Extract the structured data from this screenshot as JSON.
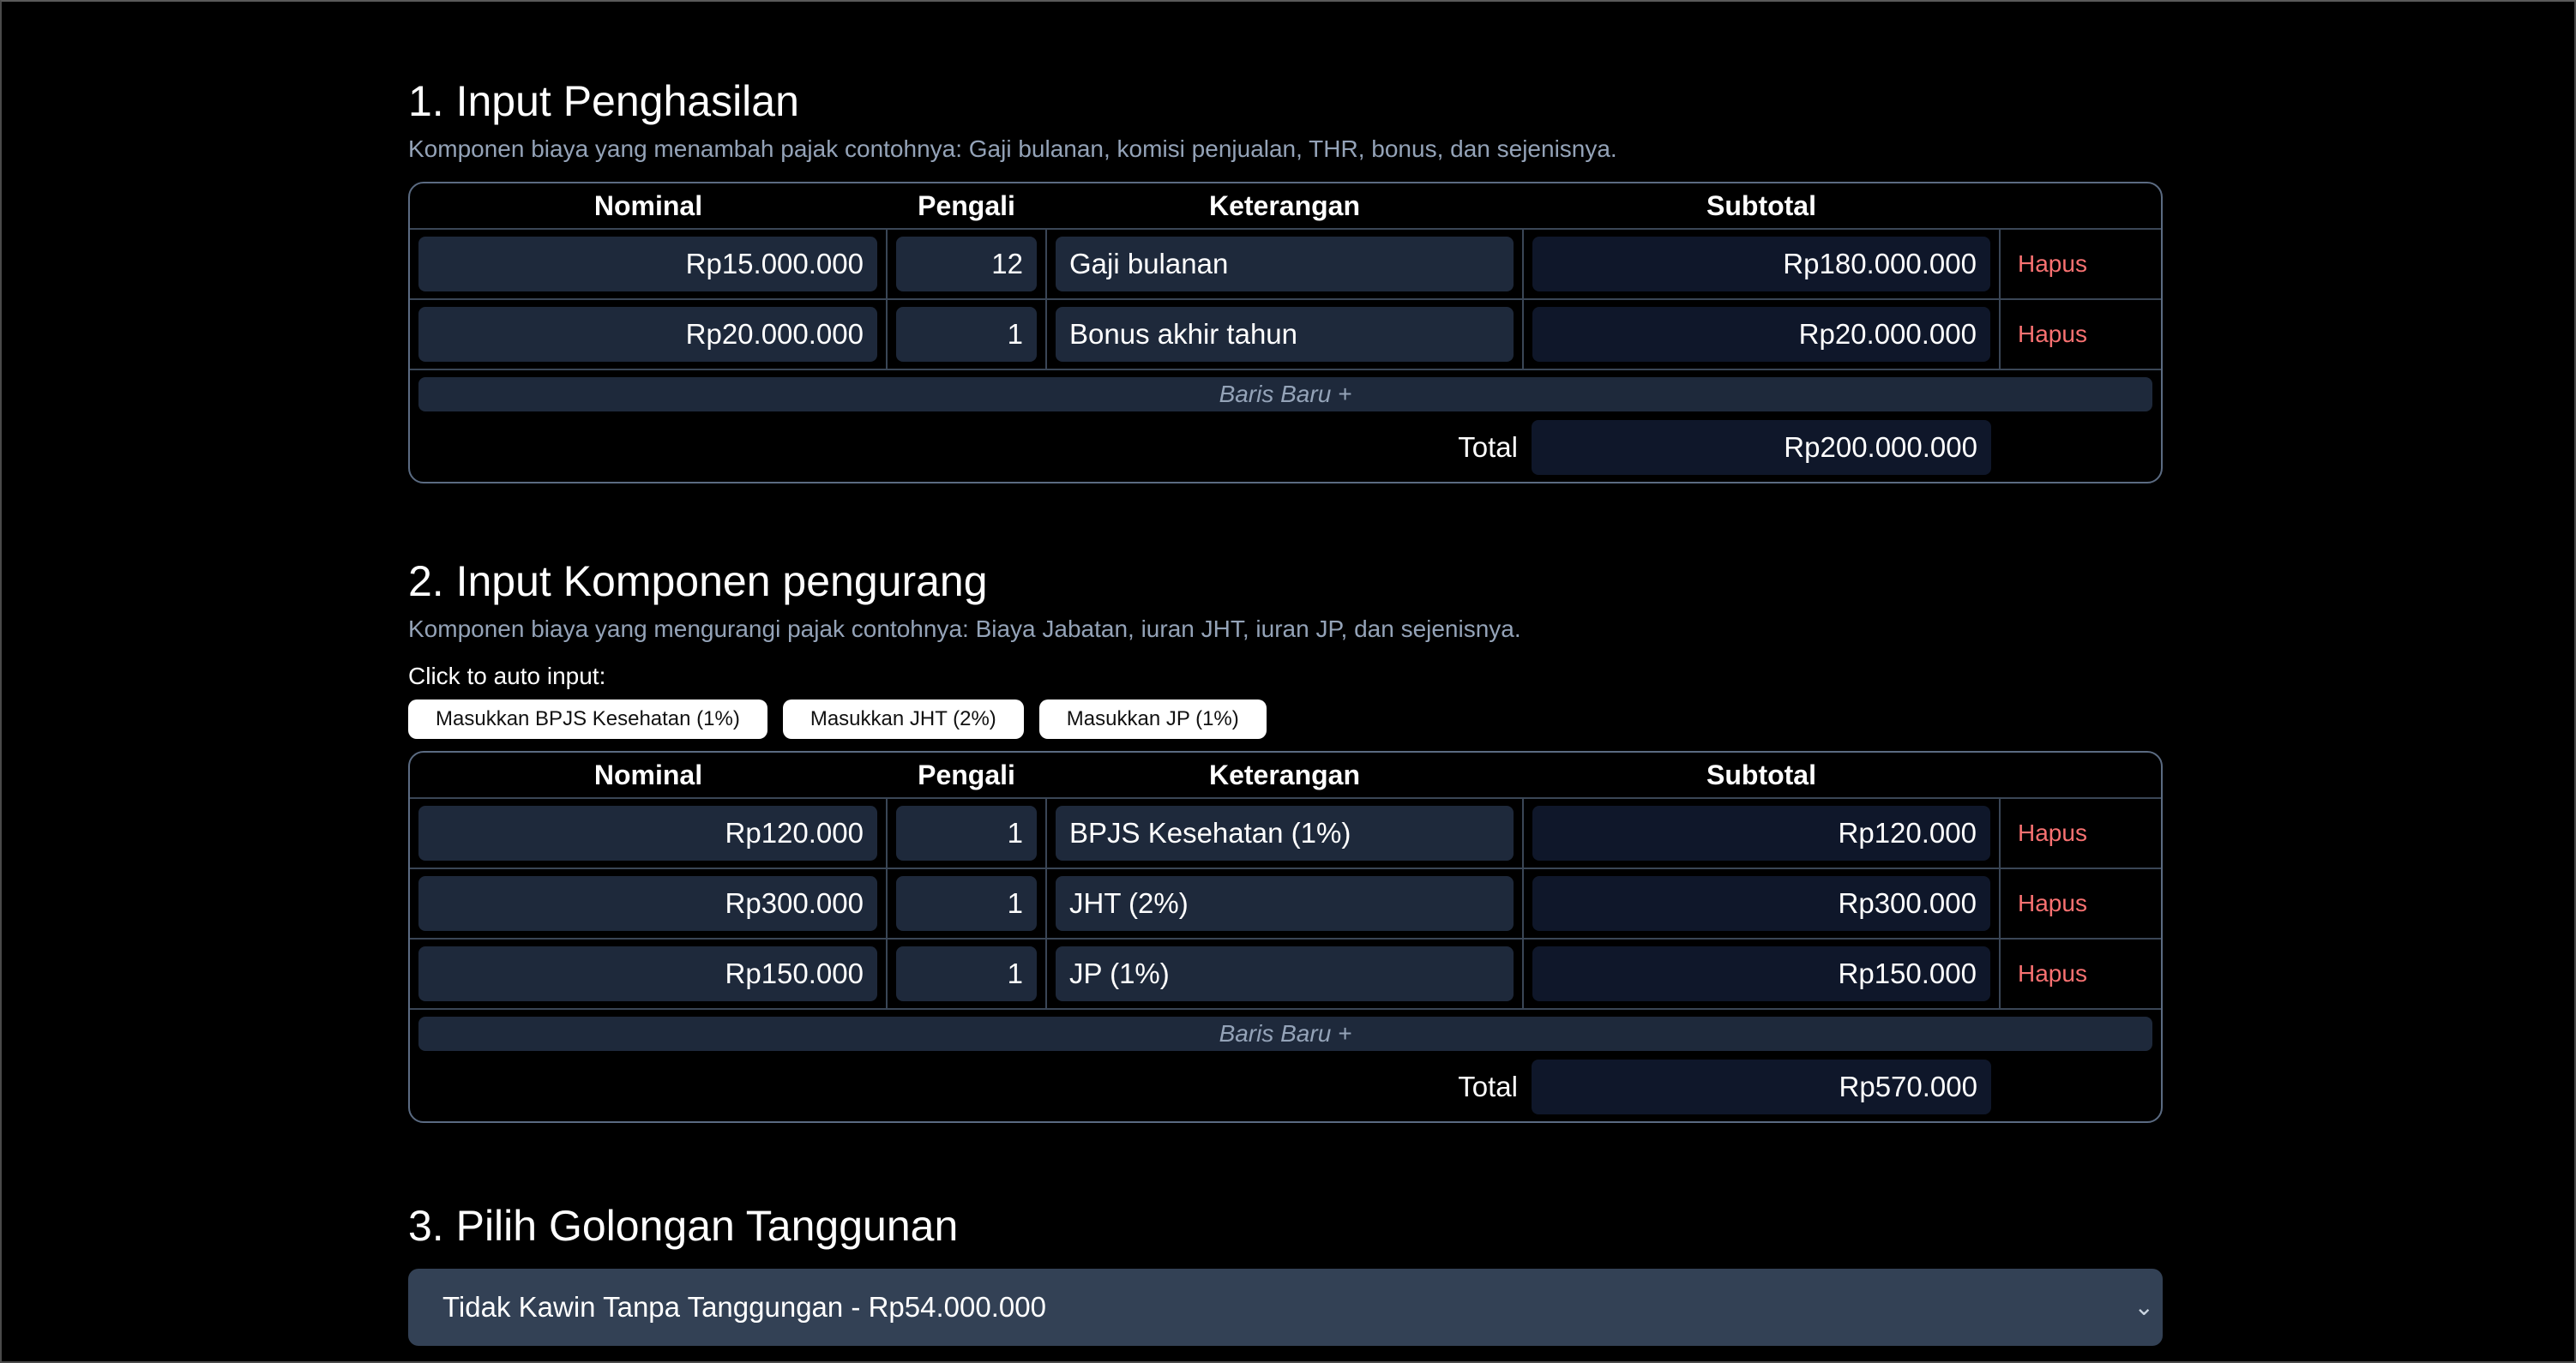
{
  "income": {
    "title": "1. Input Penghasilan",
    "description": "Komponen biaya yang menambah pajak contohnya: Gaji bulanan, komisi penjualan, THR, bonus, dan sejenisnya.",
    "columns": [
      "Nominal",
      "Pengali",
      "Keterangan",
      "Subtotal"
    ],
    "rows": [
      {
        "nominal": "Rp15.000.000",
        "pengali": "12",
        "keterangan": "Gaji bulanan",
        "subtotal": "Rp180.000.000",
        "delete": "Hapus"
      },
      {
        "nominal": "Rp20.000.000",
        "pengali": "1",
        "keterangan": "Bonus akhir tahun",
        "subtotal": "Rp20.000.000",
        "delete": "Hapus"
      }
    ],
    "new_row": "Baris Baru +",
    "total_label": "Total",
    "total_value": "Rp200.000.000"
  },
  "deduction": {
    "title": "2. Input Komponen pengurang",
    "description": "Komponen biaya yang mengurangi pajak contohnya: Biaya Jabatan, iuran JHT, iuran JP, dan sejenisnya.",
    "auto_label": "Click to auto input:",
    "auto_buttons": [
      "Masukkan BPJS Kesehatan (1%)",
      "Masukkan JHT (2%)",
      "Masukkan JP (1%)"
    ],
    "columns": [
      "Nominal",
      "Pengali",
      "Keterangan",
      "Subtotal"
    ],
    "rows": [
      {
        "nominal": "Rp120.000",
        "pengali": "1",
        "keterangan": "BPJS Kesehatan (1%)",
        "subtotal": "Rp120.000",
        "delete": "Hapus"
      },
      {
        "nominal": "Rp300.000",
        "pengali": "1",
        "keterangan": "JHT (2%)",
        "subtotal": "Rp300.000",
        "delete": "Hapus"
      },
      {
        "nominal": "Rp150.000",
        "pengali": "1",
        "keterangan": "JP (1%)",
        "subtotal": "Rp150.000",
        "delete": "Hapus"
      }
    ],
    "new_row": "Baris Baru +",
    "total_label": "Total",
    "total_value": "Rp570.000"
  },
  "dependents": {
    "title": "3. Pilih Golongan Tanggunan",
    "selected": "Tidak Kawin Tanpa Tanggungan - Rp54.000.000"
  },
  "icons": {
    "select_chevron": "chevron-down-icon"
  },
  "colors": {
    "background": "#000000",
    "input_bg": "#1e293b",
    "delete": "#f87171",
    "muted": "#94a3b8"
  }
}
